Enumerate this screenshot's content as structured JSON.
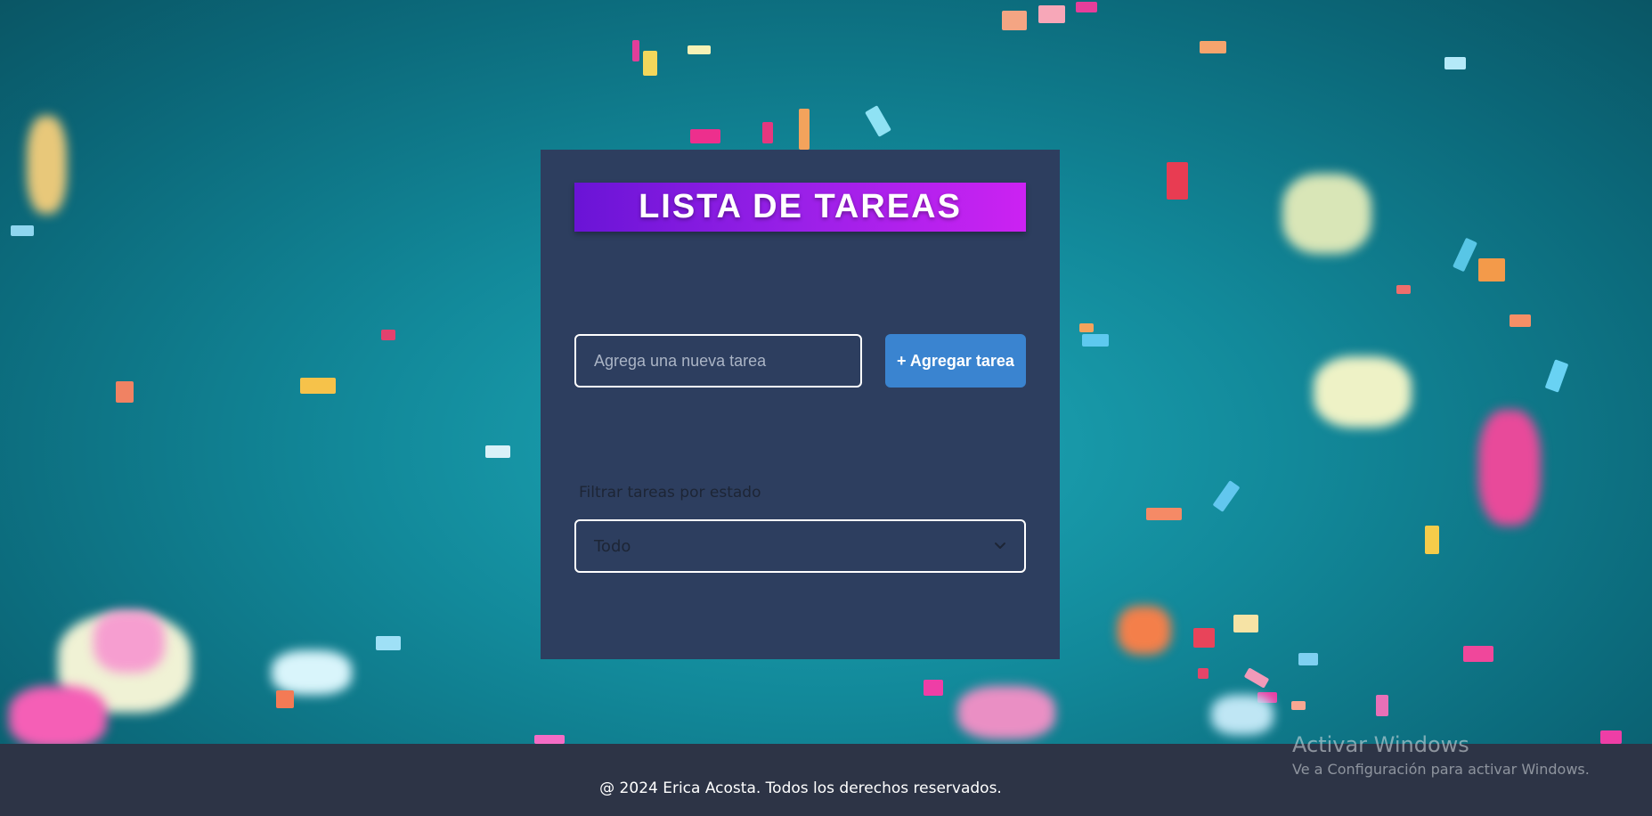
{
  "app": {
    "title": "LISTA DE TAREAS"
  },
  "task_form": {
    "input_placeholder": "Agrega una nueva tarea",
    "input_value": "",
    "add_button_label": "+ Agregar tarea"
  },
  "filter": {
    "label": "Filtrar tareas por estado",
    "selected": "Todo"
  },
  "footer": {
    "text": "@ 2024 Erica Acosta. Todos los derechos reservados."
  },
  "windows_watermark": {
    "title": "Activar Windows",
    "subtitle": "Ve a Configuración para activar Windows."
  },
  "colors": {
    "card_bg": "#2d3e5f",
    "title_gradient_start": "#6a14d6",
    "title_gradient_end": "#cc22f2",
    "button_bg": "#3a84d0",
    "footer_bg": "#2d3446",
    "background": "#1ea9b8"
  },
  "icons": {
    "select_chevron": "chevron-down-icon"
  }
}
